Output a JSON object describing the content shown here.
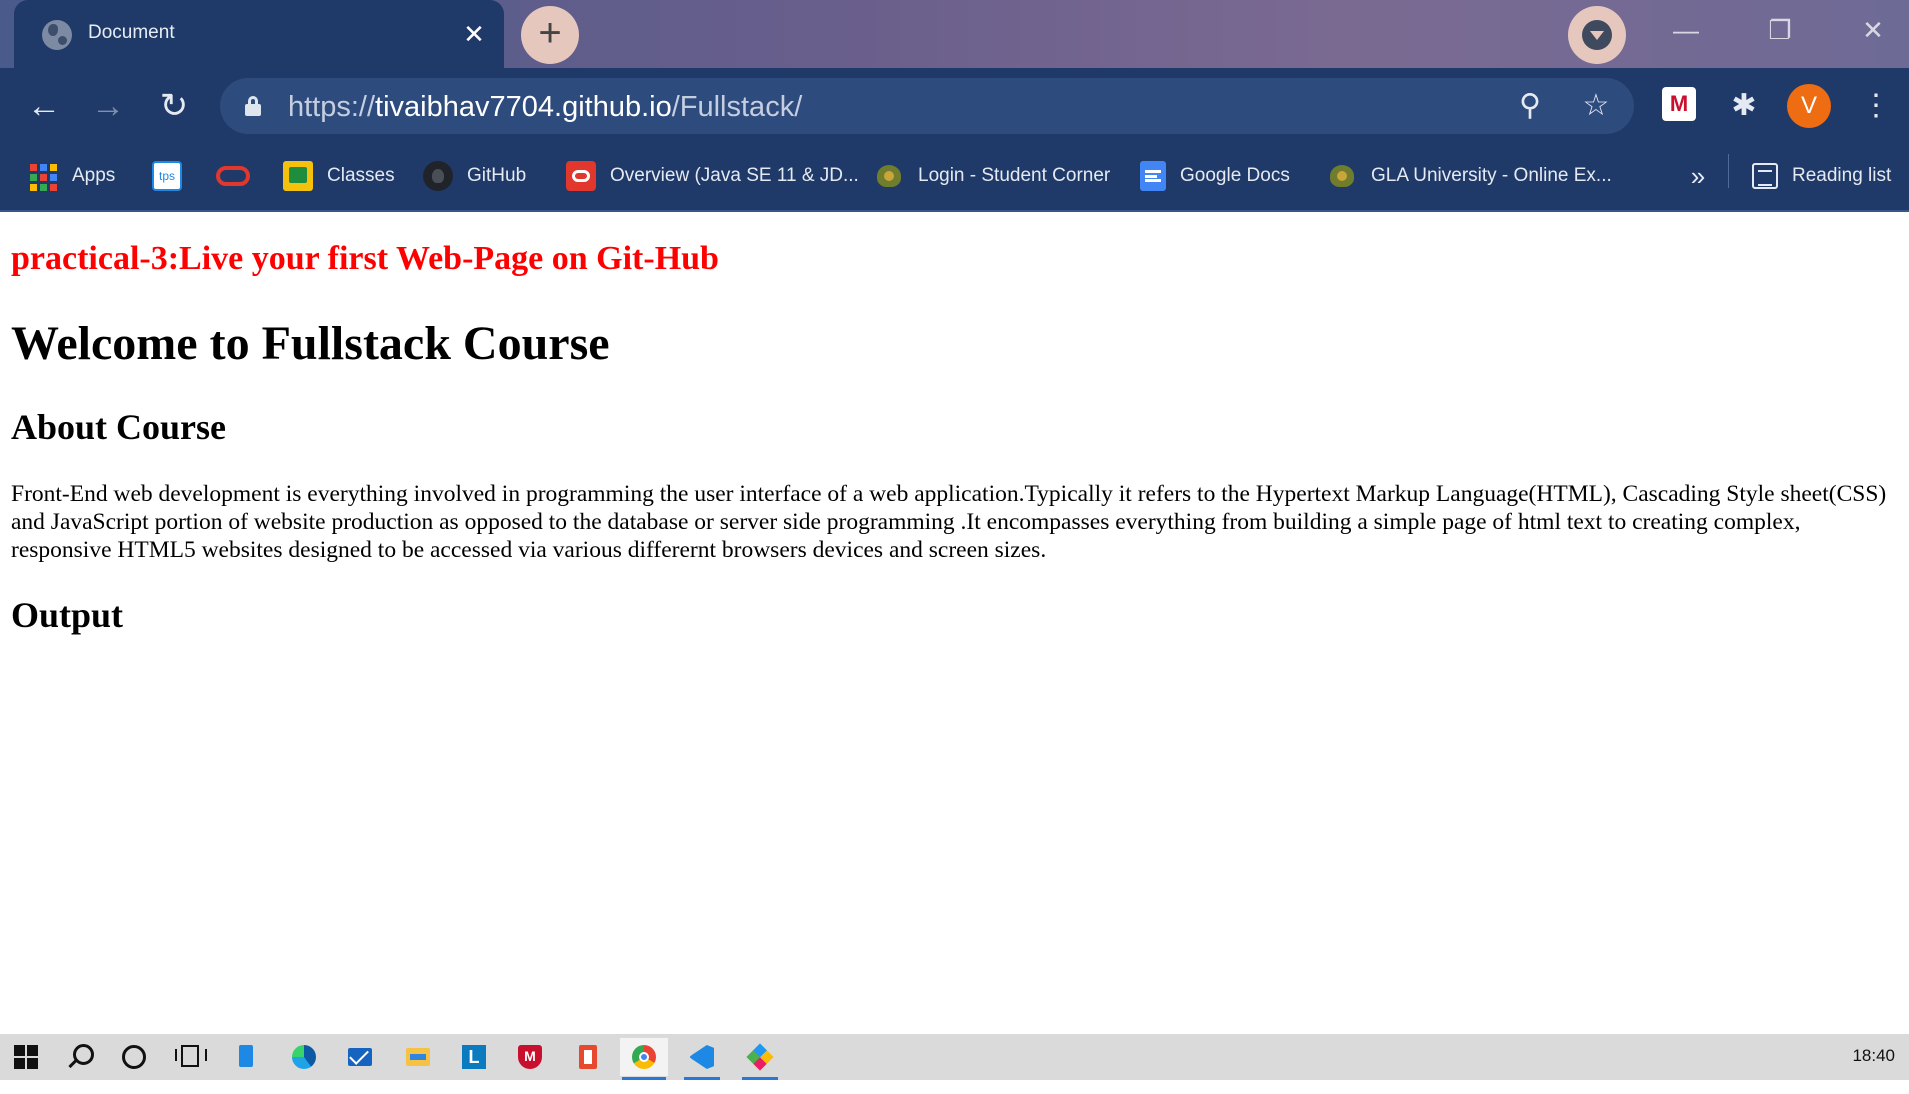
{
  "browser": {
    "tab": {
      "title": "Document",
      "close_glyph": "✕"
    },
    "new_tab_glyph": "+",
    "window_controls": {
      "minimize": "—",
      "restore": "❐",
      "close": "✕"
    },
    "nav": {
      "back": "←",
      "forward": "→",
      "reload": "↻"
    },
    "address": {
      "scheme": "https://",
      "host": "tivaibhav7704.github.io",
      "path": "/Fullstack/"
    },
    "omnibox_icons": {
      "zoom": "⚲",
      "bookmark": "☆"
    },
    "toolbar_icons": {
      "extensions": "✱",
      "menu": "⋮"
    },
    "profile_initial": "V",
    "bookmarks": [
      {
        "label": "Apps",
        "icon": "apps-grid-icon"
      },
      {
        "label": "",
        "icon": "tps-icon"
      },
      {
        "label": "",
        "icon": "oracle-icon"
      },
      {
        "label": "Classes",
        "icon": "google-classroom-icon"
      },
      {
        "label": "GitHub",
        "icon": "github-icon"
      },
      {
        "label": "Overview (Java SE 11 & JD...",
        "icon": "oracle-red-icon"
      },
      {
        "label": "Login - Student Corner",
        "icon": "gla-emblem-icon"
      },
      {
        "label": "Google Docs",
        "icon": "google-docs-icon"
      },
      {
        "label": "GLA University - Online Ex...",
        "icon": "gla-emblem-icon"
      }
    ],
    "bookmarks_overflow": "»",
    "reading_list": "Reading list"
  },
  "page": {
    "heading_red": "practical-3:Live your first Web-Page on Git-Hub",
    "heading_main": "Welcome to Fullstack Course",
    "subheading_about": "About Course",
    "paragraph": "Front-End web development is everything involved in programming the user interface of a web application.Typically it refers to the Hypertext Markup Language(HTML), Cascading Style sheet(CSS) and JavaScript portion of website production as opposed to the database or server side programming .It encompasses everything from building a simple page of html text to creating complex, responsive HTML5 websites designed to be accessed via various differernt browsers devices and screen sizes.",
    "subheading_output": "Output"
  },
  "taskbar": {
    "apps": [
      "windows-start-icon",
      "search-icon",
      "cortana-icon",
      "task-view-icon",
      "phone-icon",
      "edge-icon",
      "mail-icon",
      "file-explorer-icon",
      "l-app-icon",
      "mcafee-icon",
      "office-icon",
      "chrome-icon",
      "vscode-icon",
      "git-icon"
    ],
    "clock": "18:40"
  },
  "colors": {
    "chrome_frame": "#1f3a68",
    "heading_red": "#ff0000",
    "avatar": "#ee6c12"
  }
}
